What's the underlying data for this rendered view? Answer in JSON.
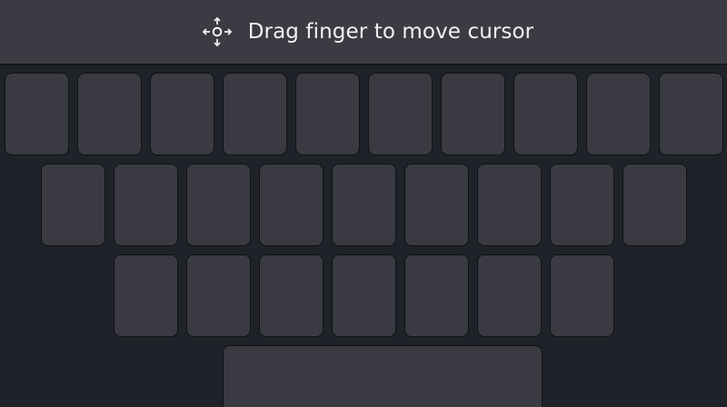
{
  "hint_bar": {
    "icon": "move-cursor-icon",
    "text": "Drag finger to move cursor"
  },
  "keyboard": {
    "rows": [
      {
        "key_count": 10
      },
      {
        "key_count": 9
      },
      {
        "key_count": 7
      }
    ],
    "has_spacebar": true
  },
  "colors": {
    "background": "#20222a",
    "hint_bar": "#3b3b43",
    "key": "#3a3a42",
    "key_border": "#101116",
    "text": "#f1f1f3"
  }
}
